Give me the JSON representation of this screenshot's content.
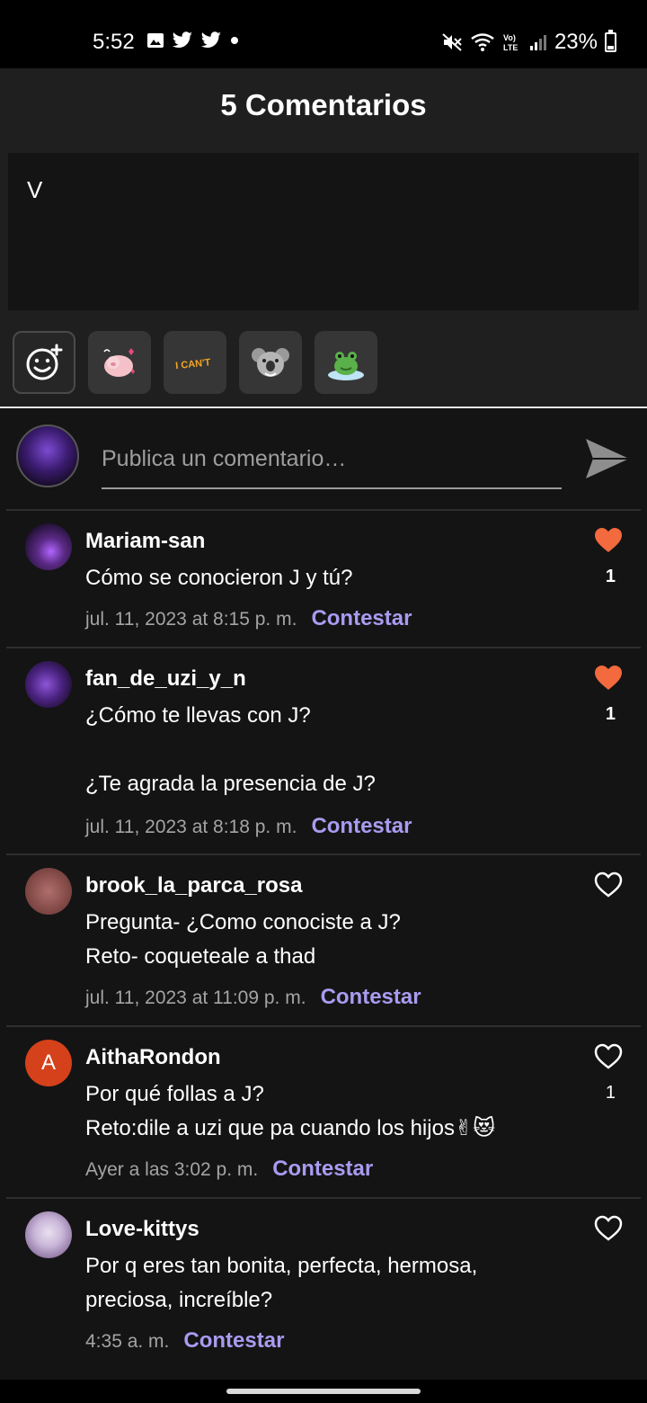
{
  "status_bar": {
    "time": "5:52",
    "battery_percent": "23%",
    "battery_level": 0.23,
    "volte_label": "Vo) LTE"
  },
  "header": {
    "title": "5 Comentarios"
  },
  "compose": {
    "text": "V"
  },
  "stickers": [
    {
      "name": "pig-sticker"
    },
    {
      "name": "i-cant-sticker",
      "text": "I CAN'T"
    },
    {
      "name": "koala-sticker"
    },
    {
      "name": "frog-sticker"
    }
  ],
  "comment_input": {
    "placeholder": "Publica un comentario…"
  },
  "comments": [
    {
      "user": "Mariam-san",
      "text": "Cómo se conocieron J y tú?",
      "time": "jul. 11, 2023 at 8:15 p. m.",
      "reply": "Contestar",
      "liked": true,
      "likes": "1",
      "avatar_color": "#5b2a86"
    },
    {
      "user": "fan_de_uzi_y_n",
      "text": "¿Cómo te llevas con J?\n\n¿Te agrada la presencia de J?",
      "time": "jul. 11, 2023 at 8:18 p. m.",
      "reply": "Contestar",
      "liked": true,
      "likes": "1",
      "avatar_color": "#6a3aa0"
    },
    {
      "user": "brook_la_parca_rosa",
      "text": "Pregunta- ¿Como conociste a J?\nReto- coqueteale a thad",
      "time": "jul. 11, 2023 at 11:09 p. m.",
      "reply": "Contestar",
      "liked": false,
      "likes": "",
      "avatar_color": "#8a4f4c"
    },
    {
      "user": "AithaRondon",
      "avatar_letter": "A",
      "text": "Por qué follas a J?\nReto:dile a uzi que pa cuando los hijos✌😻",
      "time": "Ayer a las 3:02 p. m.",
      "reply": "Contestar",
      "liked": false,
      "likes": "1",
      "avatar_color": "#d4411a"
    },
    {
      "user": "Love-kittys",
      "text": "Por q eres tan bonita, perfecta, hermosa,\npreciosa, increíble?",
      "time": "4:35 a. m.",
      "reply": "Contestar",
      "liked": false,
      "likes": "",
      "avatar_color": "#c9b6d8"
    }
  ],
  "colors": {
    "accent_reply": "#a99bf0",
    "like_active": "#f26a3d",
    "background": "#141414",
    "header_bg": "#1f1f1f"
  }
}
